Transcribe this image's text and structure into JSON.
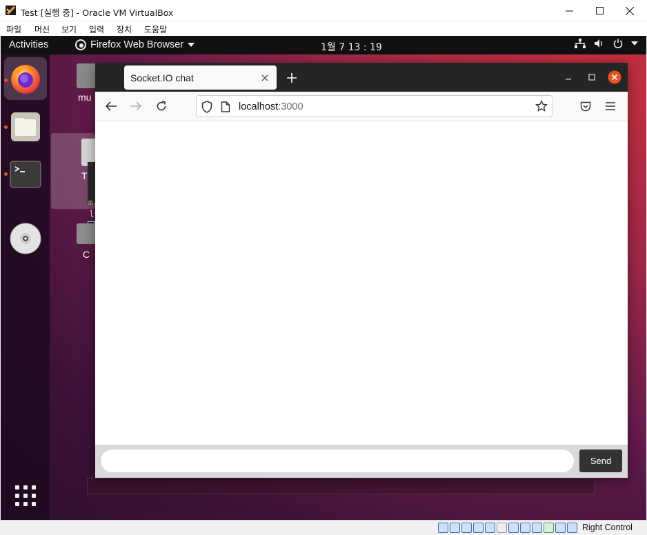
{
  "virtualbox": {
    "window_title": "Test [실행 중] - Oracle VM VirtualBox",
    "menu": [
      "파일",
      "머신",
      "보기",
      "입력",
      "장치",
      "도움말"
    ],
    "host_key_label": "Right Control"
  },
  "gnome": {
    "activities_label": "Activities",
    "app_menu_label": "Firefox Web Browser",
    "clock": "1월 7  13 : 19"
  },
  "dock": {
    "items": [
      "firefox-icon",
      "files-icon",
      "terminal-icon",
      "dvd-icon",
      "show-applications-icon"
    ]
  },
  "desktop": {
    "home_label_partial": "mu",
    "trash_label_partial": "T",
    "folder_label_partial": "C",
    "terminal_text_partial_1": "m",
    "terminal_text_partial_2": "l"
  },
  "firefox": {
    "tab_title": "Socket.IO chat",
    "url_host": "localhost",
    "url_port": ":3000"
  },
  "chat": {
    "input_value": "",
    "send_label": "Send"
  },
  "colors": {
    "ubuntu_orange": "#e95420",
    "send_button": "#333333",
    "form_background": "#d9d9d9"
  }
}
